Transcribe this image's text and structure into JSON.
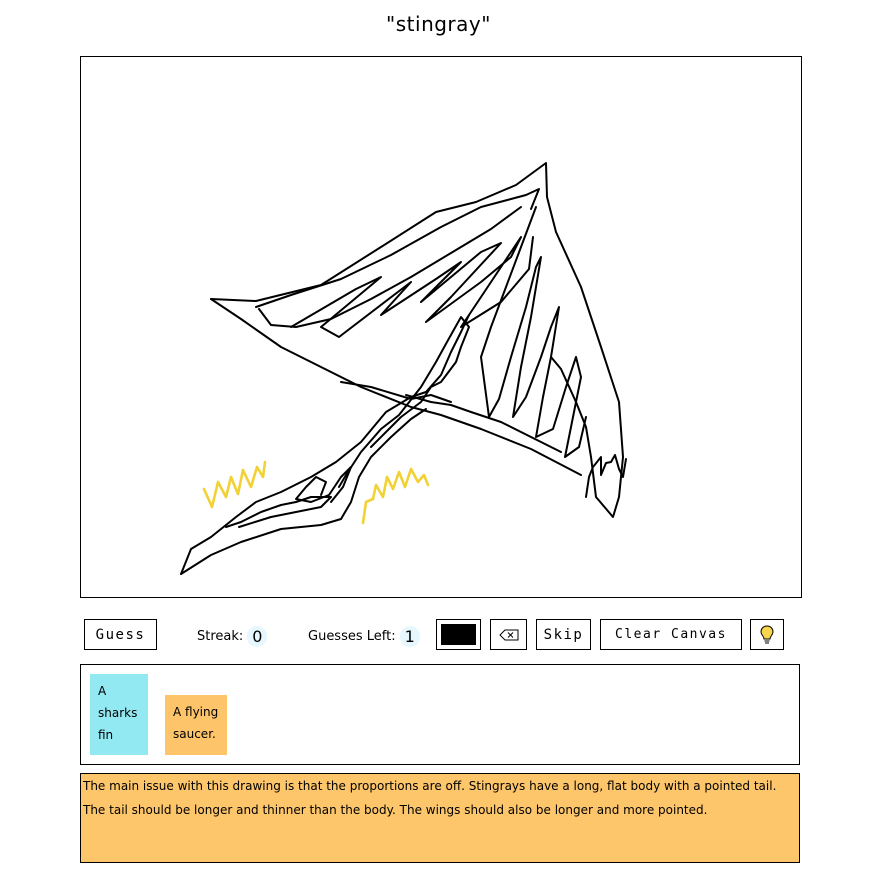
{
  "prompt": "\"stingray\"",
  "toolbar": {
    "guess_label": "Guess",
    "streak_label": "Streak:",
    "streak_value": "0",
    "guesses_left_label": "Guesses Left:",
    "guesses_left_value": "1",
    "brush_color": "#000000",
    "undo_icon": "backspace-icon",
    "skip_label": "Skip",
    "clear_label": "Clear Canvas",
    "hint_icon": "lightbulb-icon"
  },
  "guesses": [
    {
      "text": "A sharks fin",
      "color": "#93e9f1"
    },
    {
      "text": "A flying saucer.",
      "color": "#fdc46a"
    }
  ],
  "feedback": {
    "text": "The main issue with this drawing is that the proportions are off. Stingrays have a long, flat body with a pointed tail. The tail should be longer and thinner than the body. The wings should also be longer and more pointed.",
    "color": "#fec66a"
  },
  "colors": {
    "stroke": "#000000",
    "motion_lines": "#f2d134"
  }
}
